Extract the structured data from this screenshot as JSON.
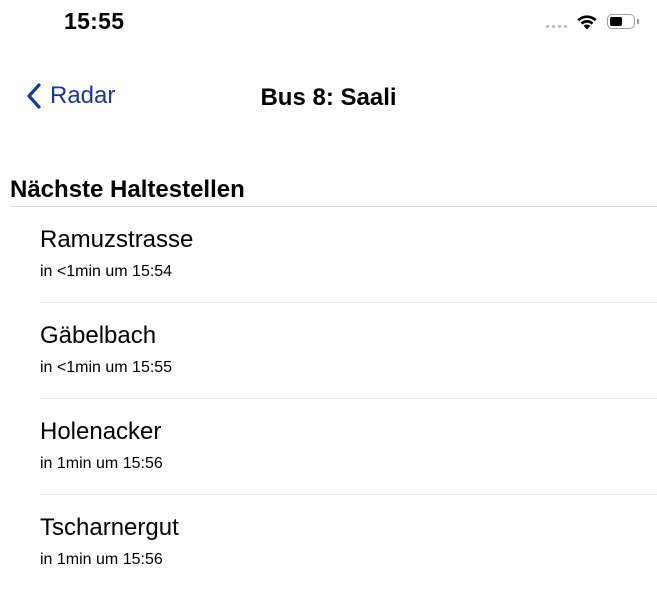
{
  "status_bar": {
    "time": "15:55",
    "battery_level": 0.55,
    "icons": [
      "signal-dots-icon",
      "wifi-icon",
      "battery-icon"
    ]
  },
  "nav": {
    "back_label": "Radar",
    "back_icon": "chevron-left-icon",
    "title": "Bus 8: Saali",
    "accent_color": "#1a36a0"
  },
  "section": {
    "title": "Nächste Haltestellen"
  },
  "stops": [
    {
      "name": "Ramuzstrasse",
      "info": "in <1min um 15:54"
    },
    {
      "name": "Gäbelbach",
      "info": "in <1min um 15:55"
    },
    {
      "name": "Holenacker",
      "info": "in 1min um 15:56"
    },
    {
      "name": "Tscharnergut",
      "info": "in 1min um 15:56"
    }
  ]
}
